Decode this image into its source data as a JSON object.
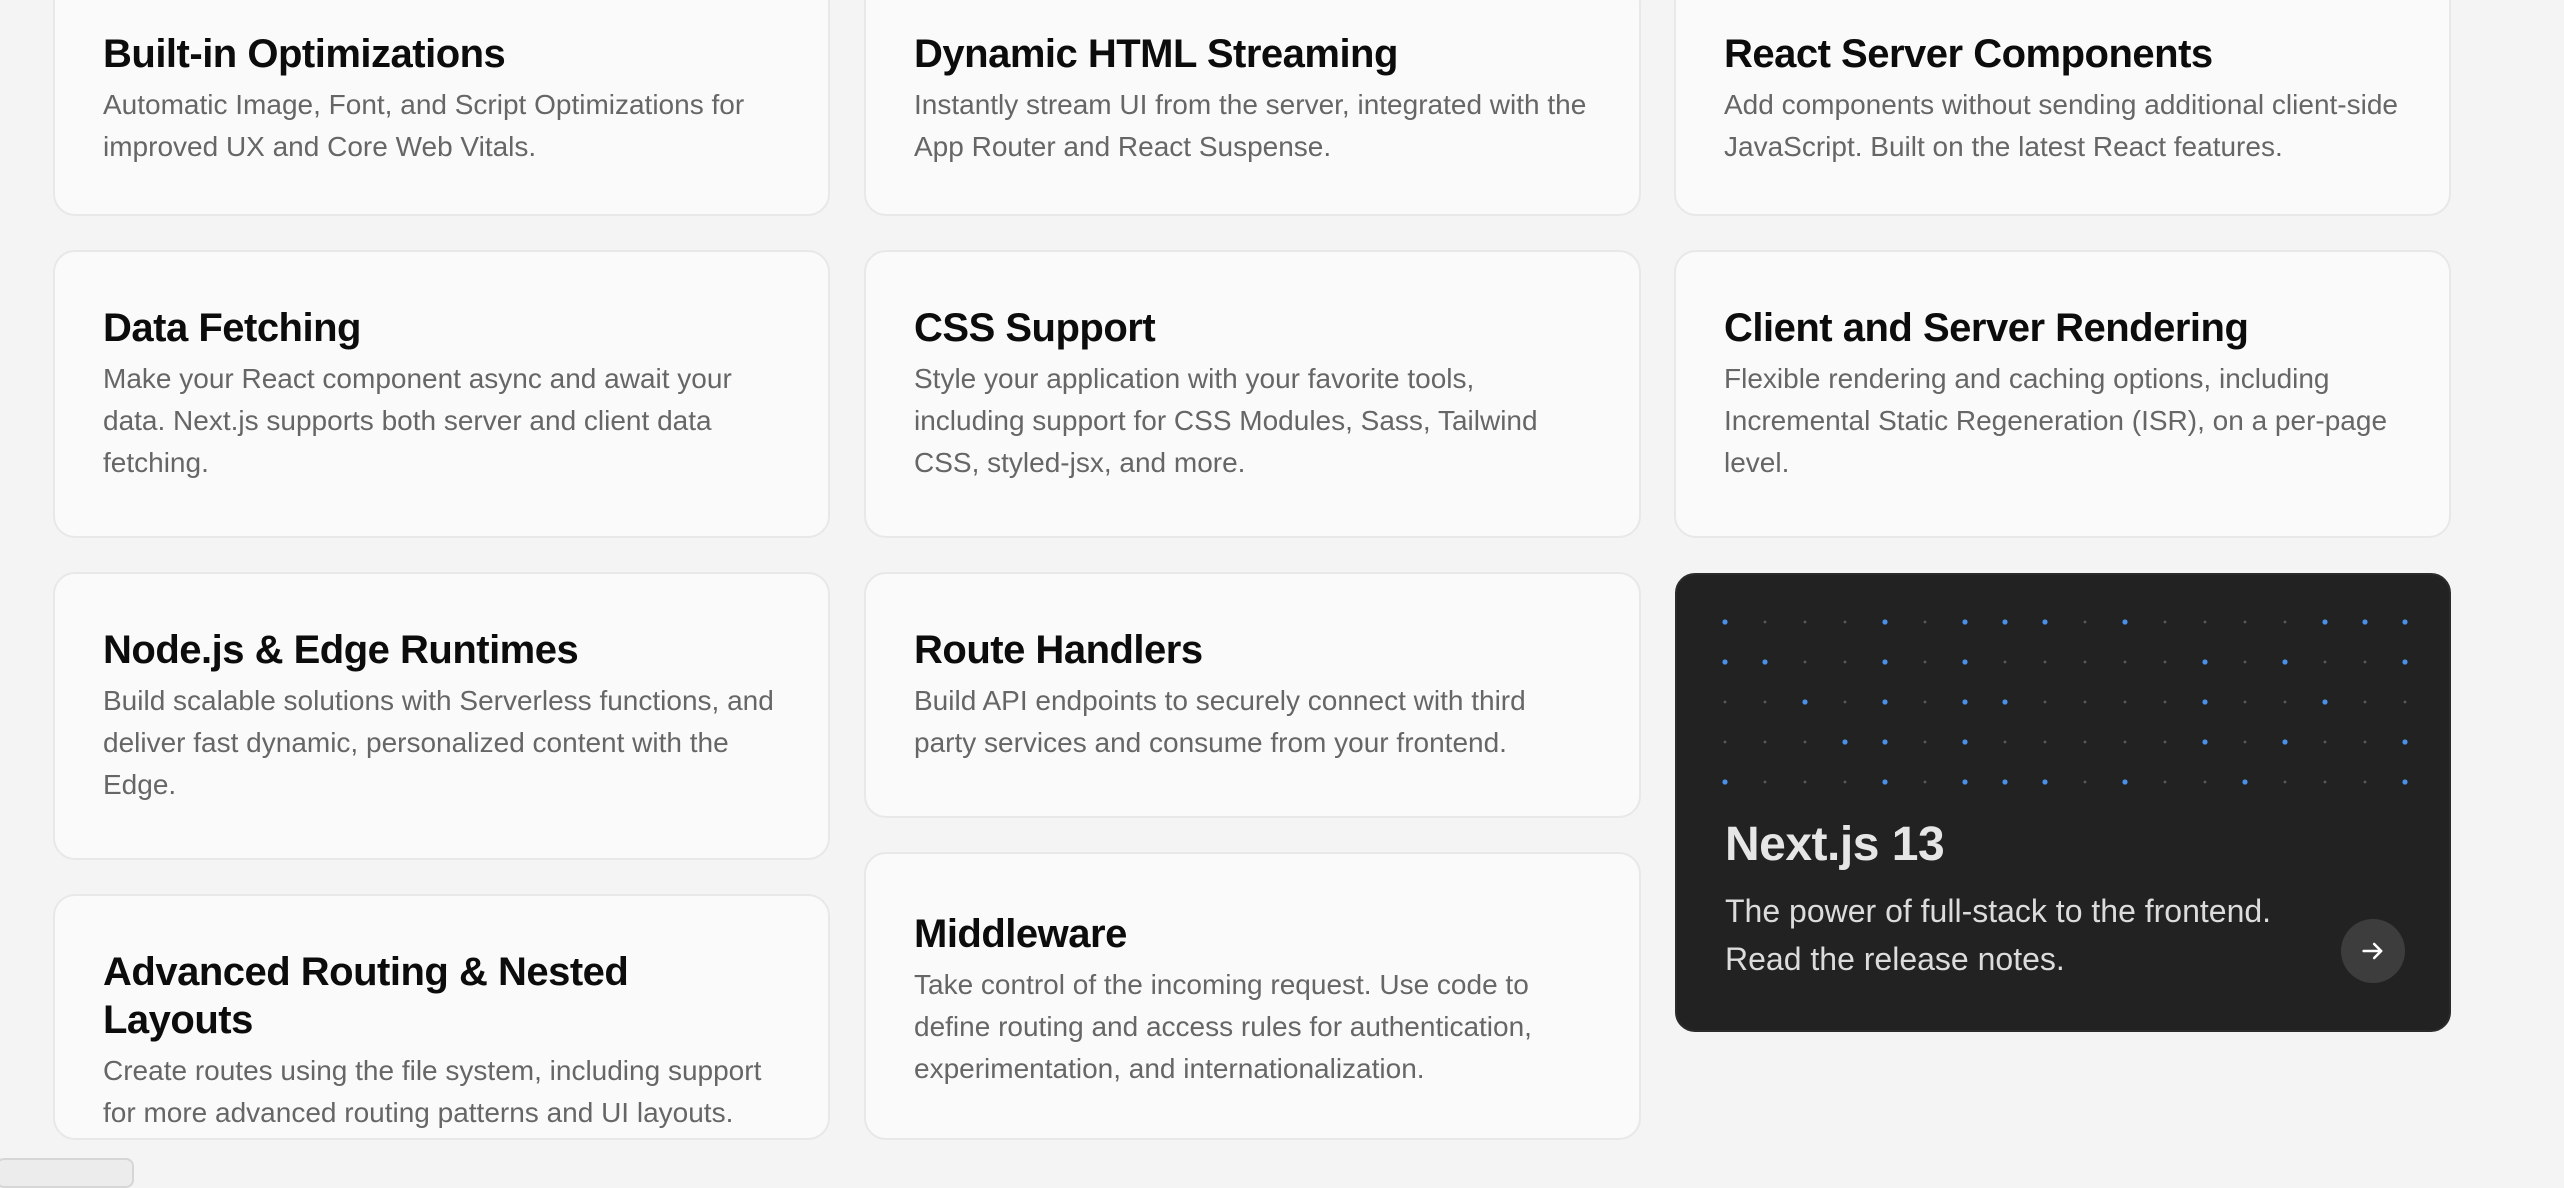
{
  "features": [
    {
      "title": "Built-in Optimizations",
      "desc": "Automatic Image, Font, and Script Optimizations for improved UX and Core Web Vitals."
    },
    {
      "title": "Dynamic HTML Streaming",
      "desc": "Instantly stream UI from the server, integrated with the App Router and React Suspense."
    },
    {
      "title": "React Server Components",
      "desc": "Add components without sending additional client-side JavaScript. Built on the latest React features."
    },
    {
      "title": "Data Fetching",
      "desc": "Make your React component async and await your data. Next.js supports both server and client data fetching."
    },
    {
      "title": "CSS Support",
      "desc": "Style your application with your favorite tools, including support for CSS Modules, Sass, Tailwind CSS, styled-jsx, and more."
    },
    {
      "title": "Client and Server Rendering",
      "desc": "Flexible rendering and caching options, including Incremental Static Regeneration (ISR), on a per-page level."
    },
    {
      "title": "Node.js & Edge Runtimes",
      "desc": "Build scalable solutions with Serverless functions, and deliver fast dynamic, personalized content with the Edge."
    },
    {
      "title": "Route Handlers",
      "desc": "Build API endpoints to securely connect with third party services and consume from your frontend."
    },
    {
      "title": "Advanced Routing & Nested Layouts",
      "desc": "Create routes using the file system, including support for more advanced routing patterns and UI layouts."
    },
    {
      "title": "Middleware",
      "desc": "Take control of the incoming request. Use code to define routing and access rules for authentication, experimentation, and internationalization."
    }
  ],
  "promo": {
    "title": "Next.js 13",
    "desc": "The power of full-stack to the frontend. Read the release notes.",
    "arrow_icon": "arrow-right-icon",
    "dot_color": "#4a8fe8"
  }
}
